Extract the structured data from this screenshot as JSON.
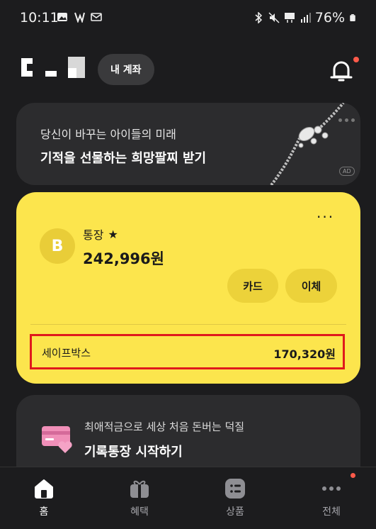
{
  "status_bar": {
    "time": "10:11",
    "battery": "76%"
  },
  "header": {
    "account_button": "내 계좌"
  },
  "ad_banner": {
    "subtitle": "당신이 바꾸는 아이들의 미래",
    "title": "기적을 선물하는 희망팔찌 받기",
    "badge": "AD"
  },
  "account_card": {
    "name": "통장",
    "star": "★",
    "balance": "242,996원",
    "card_button": "카드",
    "transfer_button": "이체",
    "safebox_label": "세이프박스",
    "safebox_amount": "170,320원",
    "avatar_letter": "B"
  },
  "promo": {
    "subtitle": "최애적금으로 세상 처음 돈버는 덕질",
    "title": "기록통장 시작하기"
  },
  "bottom_nav": {
    "home": "홈",
    "benefit": "혜택",
    "product": "상품",
    "all": "전체"
  },
  "colors": {
    "background": "#1c1c1e",
    "card_dark": "#2c2c2e",
    "account_card": "#fce54d",
    "highlight_border": "#e0191c",
    "notification_dot": "#ff5a4a"
  }
}
